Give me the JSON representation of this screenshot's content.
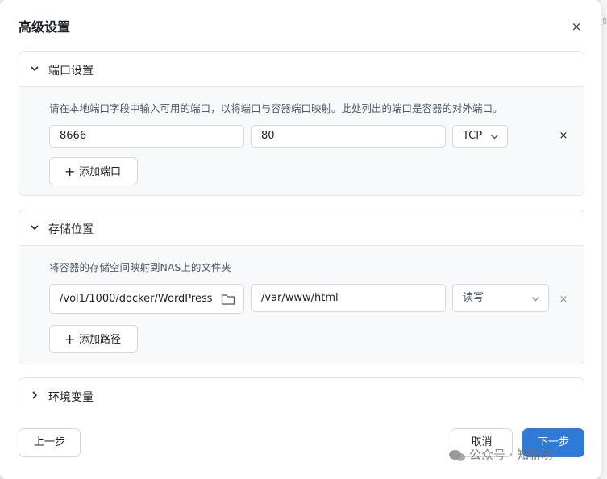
{
  "dialog": {
    "title": "高级设置",
    "close_glyph": "×"
  },
  "ports": {
    "title": "端口设置",
    "description": "请在本地端口字段中输入可用的端口，以将端口与容器端口映射。此处列出的端口是容器的对外端口。",
    "rows": [
      {
        "local_port": "8666",
        "container_port": "80",
        "protocol": "TCP"
      }
    ],
    "add_label": "添加端口"
  },
  "storage": {
    "title": "存储位置",
    "description": "将容器的存储空间映射到NAS上的文件夹",
    "rows": [
      {
        "host_path": "/vol1/1000/docker/WordPress",
        "container_path": "/var/www/html",
        "permission": "读写"
      }
    ],
    "add_label": "添加路径"
  },
  "env": {
    "title": "环境变量"
  },
  "footer": {
    "prev_label": "上一步",
    "cancel_label": "取消",
    "next_label": "下一步"
  },
  "watermark": {
    "text": "公众号 · 知新坊"
  },
  "icons": {
    "collapse": "chevron-down-icon",
    "expand": "chevron-right-icon",
    "folder": "folder-icon",
    "remove": "close-icon",
    "add": "plus-icon"
  },
  "colors": {
    "primary": "#2e7ad6",
    "border": "#e4e6ea",
    "section_body": "#f7f9fb"
  }
}
